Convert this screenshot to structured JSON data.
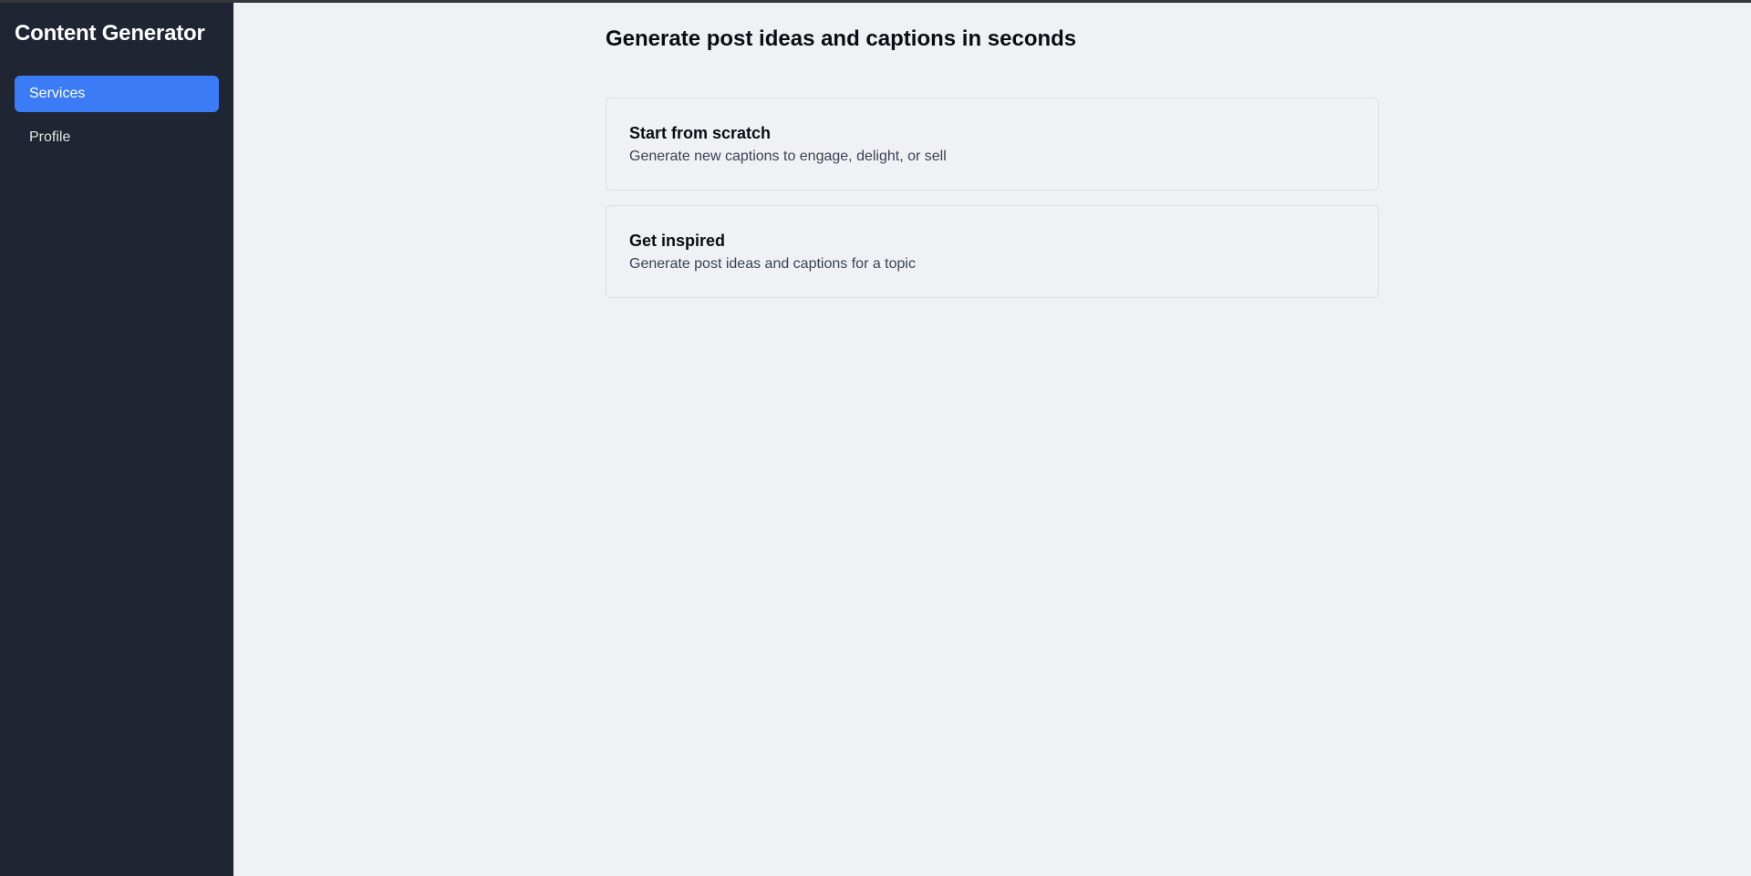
{
  "sidebar": {
    "brand": "Content Generator",
    "items": [
      {
        "label": "Services",
        "active": true
      },
      {
        "label": "Profile",
        "active": false
      }
    ]
  },
  "main": {
    "title": "Generate post ideas and captions in seconds",
    "cards": [
      {
        "title": "Start from scratch",
        "description": "Generate new captions to engage, delight, or sell"
      },
      {
        "title": "Get inspired",
        "description": "Generate post ideas and captions for a topic"
      }
    ]
  },
  "colors": {
    "sidebar_bg": "#1f2532",
    "accent": "#3b7bf6",
    "page_bg": "#eff1f5"
  }
}
